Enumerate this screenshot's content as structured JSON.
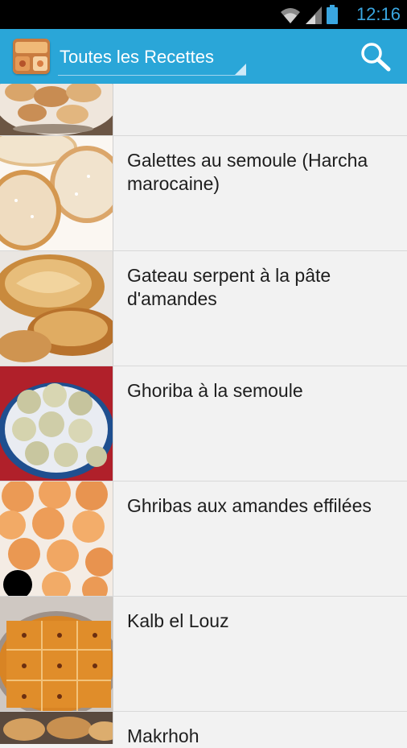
{
  "status_bar": {
    "time": "12:16",
    "icons": [
      "wifi-icon",
      "signal-icon",
      "battery-icon"
    ]
  },
  "action_bar": {
    "title": "Toutes les Recettes",
    "accent_color": "#2aa6d8",
    "search_icon": "search-icon"
  },
  "recipes": [
    {
      "title": ""
    },
    {
      "title": "Galettes au semoule (Harcha marocaine)"
    },
    {
      "title": "Gateau serpent à la pâte d'amandes"
    },
    {
      "title": "Ghoriba à la semoule"
    },
    {
      "title": "Ghribas aux amandes effilées"
    },
    {
      "title": "Kalb el Louz"
    },
    {
      "title": "Makrhoh"
    }
  ]
}
